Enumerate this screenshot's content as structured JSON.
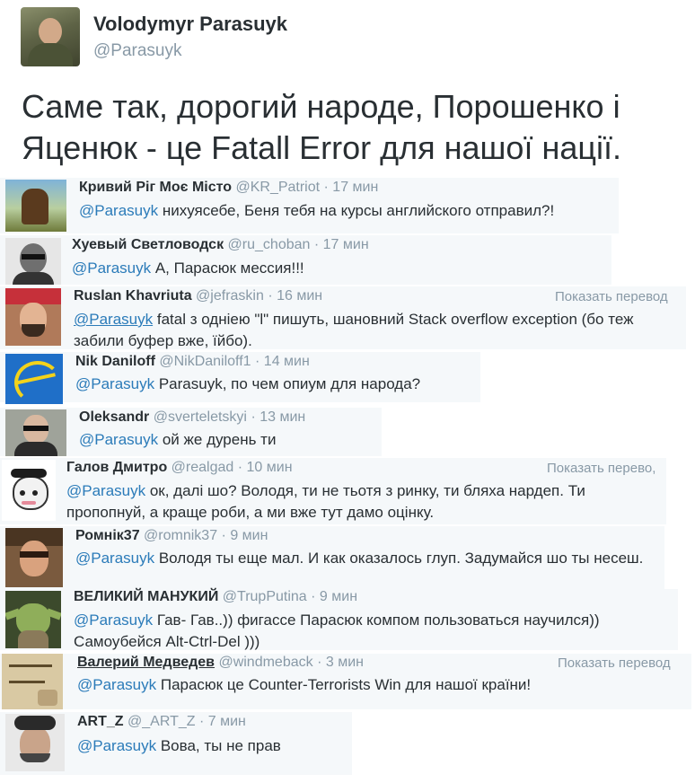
{
  "main_tweet": {
    "name": "Volodymyr Parasuyk",
    "handle": "@Parasuyk",
    "text": "Саме так, дорогий народе, Порошенко і Яценюк - це Fatall Error для нашої нації."
  },
  "replies": [
    {
      "name": "Кривий Ріг Моє Місто",
      "handle": "@KR_Patriot",
      "time": "· 17 мин",
      "mention": "@Parasuyk",
      "text": " нихуясебе, Беня тебя на курсы английского отправил?!"
    },
    {
      "name": "Хуевый Светловодск",
      "handle": "@ru_choban",
      "time": "· 17 мин",
      "mention": "@Parasuyk",
      "text": " А, Парасюк мессия!!!"
    },
    {
      "name": "Ruslan Khavriuta",
      "handle": "@jefraskin",
      "time": "· 16 мин",
      "translate": "Показать перевод",
      "mention": "@Parasuyk",
      "text": " fatal з одніею \"l\" пишуть, шановний Stack overflow exception (бо теж забили буфер вже, їйбо)."
    },
    {
      "name": "Nik Daniloff",
      "handle": "@NikDaniloff1",
      "time": "· 14 мин",
      "mention": "@Parasuyk",
      "text": " Parasuyk, по чем опиум для народа?"
    },
    {
      "name": "Oleksandr",
      "handle": "@sverteletskyi",
      "time": "· 13 мин",
      "mention": "@Parasuyk",
      "text": " ой же дурень ти"
    },
    {
      "name": "Галов Дмитро",
      "handle": "@realgad",
      "time": "· 10 мин",
      "translate": "Показать перево,",
      "mention": "@Parasuyk",
      "text": " ок, далі шо? Володя, ти не тьотя з ринку, ти бляха нардеп. Ти пропопнуй, а краще роби, а ми вже тут дамо оцінку."
    },
    {
      "name": "Ромнік37",
      "handle": "@romnik37",
      "time": "· 9 мин",
      "mention": "@Parasuyk",
      "text": " Володя ты еще мал. И как оказалось глуп. Задумайся шо ты несеш."
    },
    {
      "name": "ВЕЛИКИЙ МАНУКИЙ",
      "handle": "@TrupPutina",
      "time": "· 9 мин",
      "mention": "@Parasuyk",
      "text": "  Гав- Гав..)) фигассе Парасюк компом пользоваться научился)) Самоубейся  Alt-Ctrl-Del )))"
    },
    {
      "name": "Валерий Медведев",
      "handle": "@windmeback",
      "time": "· 3 мин",
      "translate": "Показать перевод",
      "mention": "@Parasuyk",
      "text": " Парасюк це Counter-Terrorists Win для нашої країни!"
    },
    {
      "name": "ART_Z",
      "handle": "@_ART_Z",
      "time": "· 7 мин",
      "mention": "@Parasuyk",
      "text": " Вова, ты не прав"
    }
  ],
  "colors": {
    "card_bg": "#f5f8fa",
    "link": "#2b7bb9",
    "muted": "#8899a6",
    "text": "#292f33"
  }
}
